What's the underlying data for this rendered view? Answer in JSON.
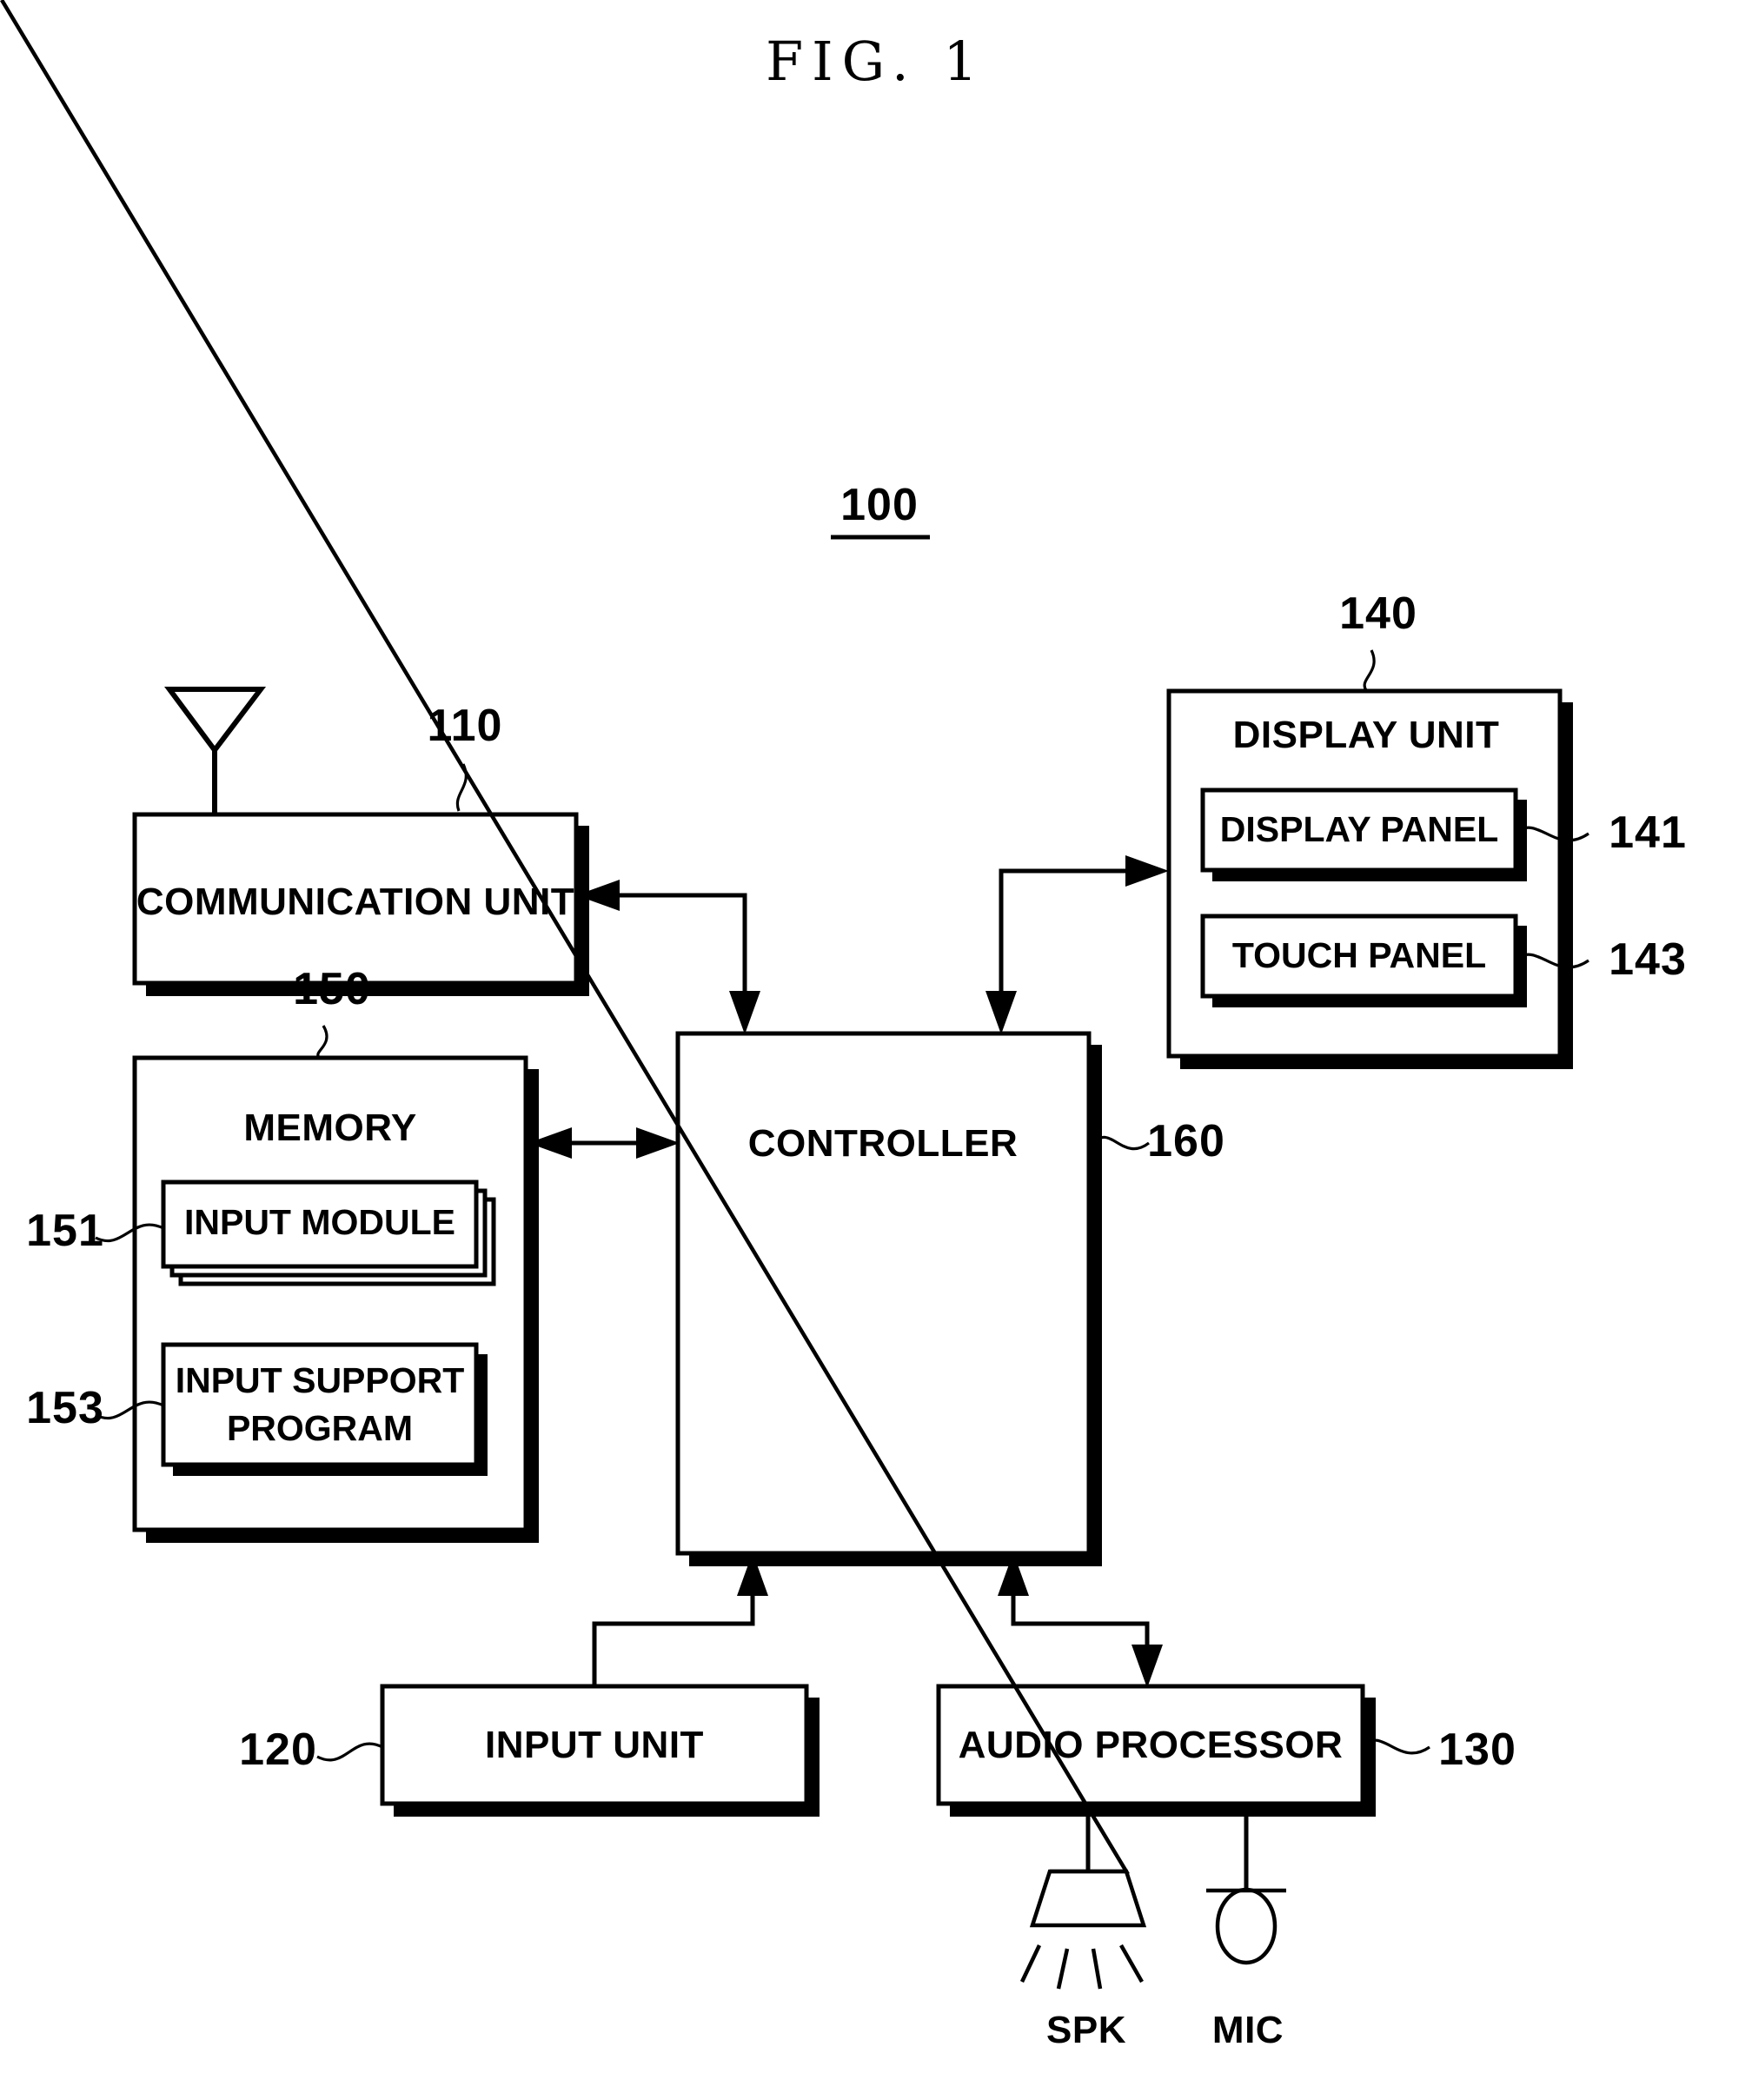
{
  "figure": {
    "title": "FIG. 1",
    "device_ref": "100"
  },
  "blocks": {
    "communication_unit": {
      "label": "COMMUNICATION UNIT",
      "ref": "110"
    },
    "display_unit": {
      "label": "DISPLAY UNIT",
      "ref": "140"
    },
    "display_panel": {
      "label": "DISPLAY PANEL",
      "ref": "141"
    },
    "touch_panel": {
      "label": "TOUCH PANEL",
      "ref": "143"
    },
    "memory": {
      "label": "MEMORY",
      "ref": "150"
    },
    "input_module": {
      "label": "INPUT MODULE",
      "ref": "151"
    },
    "input_support_program": {
      "label_line1": "INPUT SUPPORT",
      "label_line2": "PROGRAM",
      "ref": "153"
    },
    "controller": {
      "label": "CONTROLLER",
      "ref": "160"
    },
    "input_unit": {
      "label": "INPUT UNIT",
      "ref": "120"
    },
    "audio_processor": {
      "label": "AUDIO PROCESSOR",
      "ref": "130"
    }
  },
  "peripherals": {
    "speaker": {
      "label": "SPK",
      "icon": "speaker-icon"
    },
    "microphone": {
      "label": "MIC",
      "icon": "microphone-icon"
    },
    "antenna": {
      "icon": "antenna-icon"
    }
  },
  "connections": [
    {
      "from": "controller",
      "to": "communication_unit",
      "type": "bidirectional"
    },
    {
      "from": "controller",
      "to": "display_unit",
      "type": "bidirectional"
    },
    {
      "from": "controller",
      "to": "memory",
      "type": "bidirectional"
    },
    {
      "from": "input_unit",
      "to": "controller",
      "type": "unidirectional"
    },
    {
      "from": "controller",
      "to": "audio_processor",
      "type": "bidirectional"
    },
    {
      "from": "audio_processor",
      "to": "speaker",
      "type": "line"
    },
    {
      "from": "audio_processor",
      "to": "microphone",
      "type": "line"
    }
  ],
  "colors": {
    "ink": "#000000",
    "paper": "#ffffff"
  }
}
